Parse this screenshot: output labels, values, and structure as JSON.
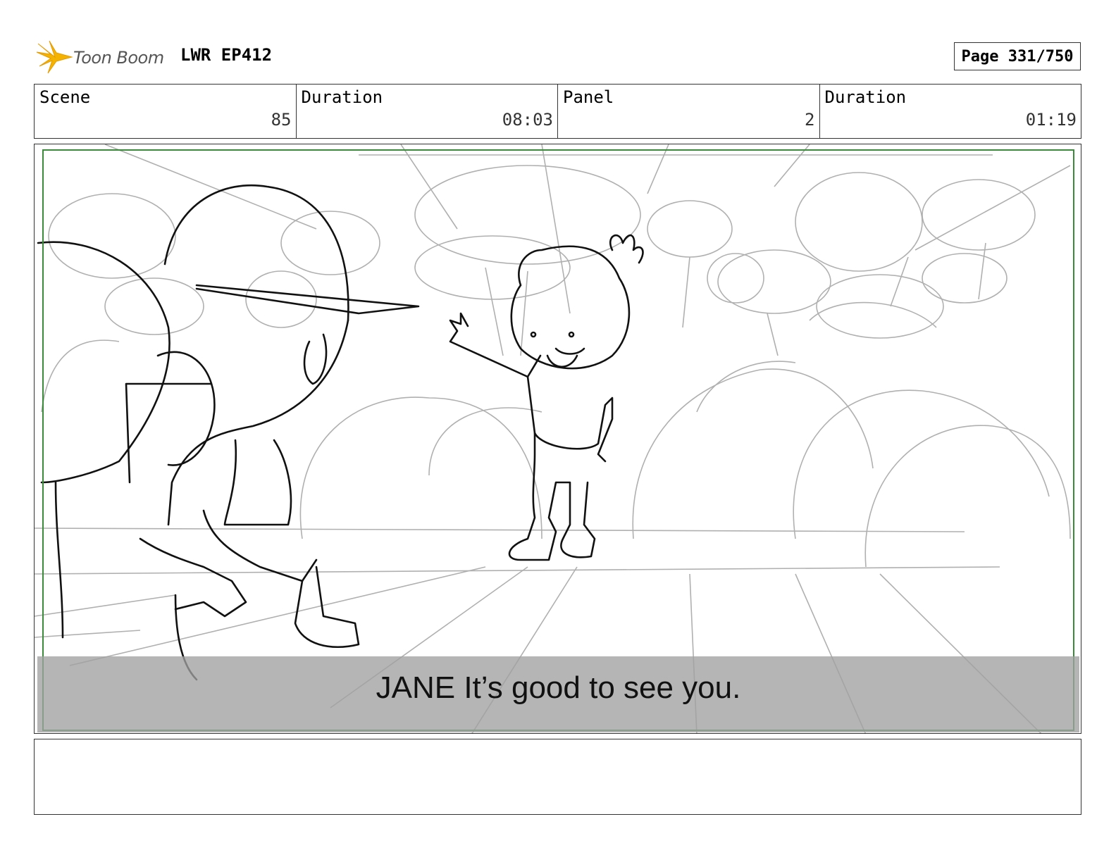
{
  "header": {
    "logo_text": "Toon Boom",
    "project_title": "LWR EP412",
    "page_label": "Page 331/750"
  },
  "info": {
    "scene_label": "Scene",
    "scene_value": "85",
    "scene_duration_label": "Duration",
    "scene_duration_value": "08:03",
    "panel_label": "Panel",
    "panel_value": "2",
    "panel_duration_label": "Duration",
    "panel_duration_value": "01:19"
  },
  "panel": {
    "caption": "JANE It’s good to see you."
  },
  "colors": {
    "safe_frame": "#3a8a3a",
    "logo_orange": "#f5b301"
  }
}
